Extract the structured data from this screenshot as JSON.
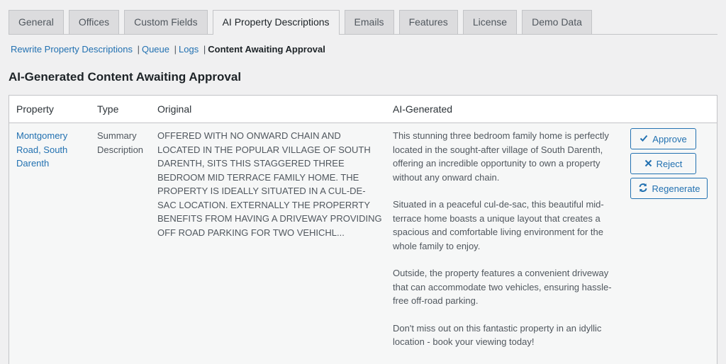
{
  "tabs": [
    {
      "label": "General"
    },
    {
      "label": "Offices"
    },
    {
      "label": "Custom Fields"
    },
    {
      "label": "AI Property Descriptions",
      "active": true
    },
    {
      "label": "Emails"
    },
    {
      "label": "Features"
    },
    {
      "label": "License"
    },
    {
      "label": "Demo Data"
    }
  ],
  "subnav": {
    "rewrite": "Rewrite Property Descriptions",
    "queue": "Queue",
    "logs": "Logs",
    "current": "Content Awaiting Approval",
    "separator": "|"
  },
  "heading": "AI-Generated Content Awaiting Approval",
  "table": {
    "columns": {
      "property": "Property",
      "type": "Type",
      "original": "Original",
      "ai": "AI-Generated"
    },
    "rows": [
      {
        "property": "Montgomery Road, South Darenth",
        "type": "Summary Description",
        "original": "OFFERED WITH NO ONWARD CHAIN AND LOCATED IN THE POPULAR VILLAGE OF SOUTH DARENTH, SITS THIS STAGGERED THREE BEDROOM MID TERRACE FAMILY HOME. THE PROPERTY IS IDEALLY SITUATED IN A CUL-DE-SAC LOCATION. EXTERNALLY THE PROPERRTY BENEFITS FROM HAVING A DRIVEWAY PROVIDING OFF ROAD PARKING FOR TWO VEHICHL...",
        "ai": [
          "This stunning three bedroom family home is perfectly located in the sought-after village of South Darenth, offering an incredible opportunity to own a property without any onward chain.",
          "Situated in a peaceful cul-de-sac, this beautiful mid-terrace home boasts a unique layout that creates a spacious and comfortable living environment for the whole family to enjoy.",
          "Outside, the property features a convenient driveway that can accommodate two vehicles, ensuring hassle-free off-road parking.",
          "Don't miss out on this fantastic property in an idyllic location - book your viewing today!"
        ],
        "actions": {
          "approve": "Approve",
          "reject": "Reject",
          "regenerate": "Regenerate"
        }
      }
    ]
  },
  "colors": {
    "link": "#2271b1",
    "background": "#f0f0f1"
  }
}
